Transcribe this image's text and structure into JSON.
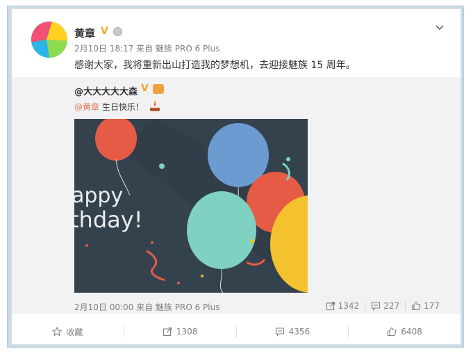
{
  "post": {
    "author": "黄章",
    "verified_badge": "V",
    "meta": "2月10日 18:17 来自 魅族 PRO 6 Plus",
    "text": "感谢大家，我将重新出山打造我的梦想机，去迎接魅族 15 周年。"
  },
  "repost": {
    "author": "@大大大大大森",
    "verified_badge": "V",
    "mention": "@黄章",
    "text": " 生日快乐！",
    "image_text_line1": "appy",
    "image_text_line2": "thday!",
    "meta": "2月10日 00:00 来自 魅族 PRO 6 Plus",
    "reposts": "1342",
    "comments": "227",
    "likes": "177"
  },
  "actions": {
    "favorite": "收藏",
    "forward": "1308",
    "comment": "4356",
    "like": "6408"
  },
  "colors": {
    "accent_orange": "#f5a623",
    "mention": "#eb7350",
    "repost_bg": "#f2f2f5",
    "photo_bg": "#34424e"
  }
}
